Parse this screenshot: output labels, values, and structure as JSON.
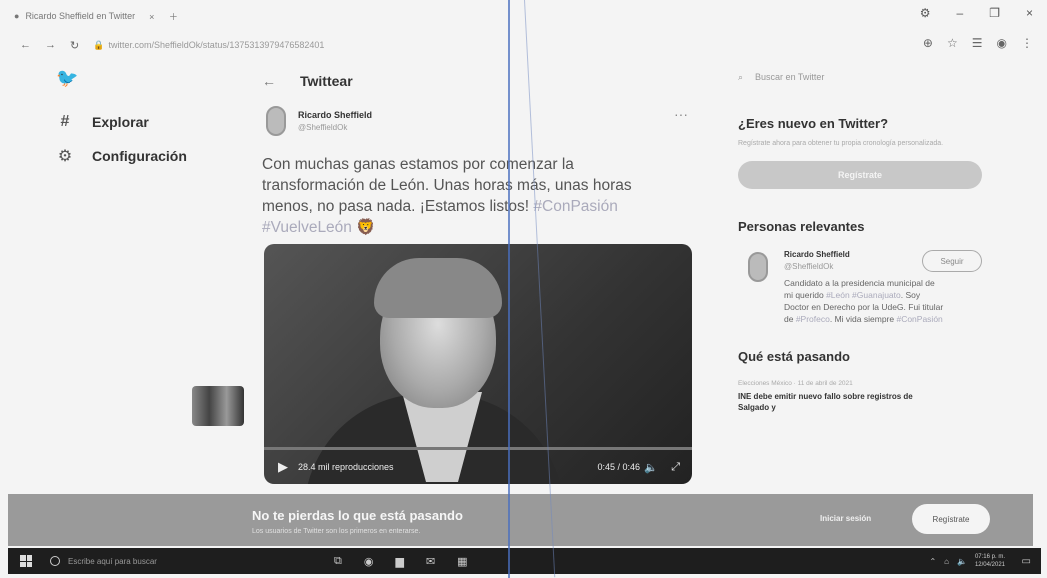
{
  "browser": {
    "tab_title": "Ricardo Sheffield en Twitter",
    "url": "twitter.com/SheffieldOk/status/1375313979476582401"
  },
  "nav": {
    "items": [
      {
        "icon": "hashtag-icon",
        "label": "Explorar"
      },
      {
        "icon": "gear-icon",
        "label": "Configuración"
      }
    ]
  },
  "tweet": {
    "header_title": "Twittear",
    "author_name": "Ricardo Sheffield",
    "author_handle": "@SheffieldOk",
    "text_line1": "Con muchas ganas estamos por comenzar la",
    "text_line2": "transformación de León. Unas horas más, unas horas",
    "text_line3": "menos, no pasa nada. ¡Estamos listos! ",
    "hashtag1": "#ConPasión",
    "hashtag2": "#VuelveLeón",
    "video_views": "28.4 mil reproducciones",
    "video_time": "0:45 / 0:46"
  },
  "sidebar": {
    "search_placeholder": "Buscar en Twitter",
    "new_title": "¿Eres nuevo en Twitter?",
    "new_subtitle": "Regístrate ahora para obtener tu propia cronología personalizada.",
    "register_label": "Regístrate",
    "people_title": "Personas relevantes",
    "person_name": "Ricardo Sheffield",
    "person_handle": "@SheffieldOk",
    "follow_label": "Seguir",
    "bio_part1": "Candidato a la presidencia municipal de mi querido ",
    "bio_tag1": "#León #Guanajuato",
    "bio_part2": ". Soy Doctor en Derecho por la UdeG. Fui titular de ",
    "bio_tag2": "#Profeco",
    "bio_part3": ". Mi vida siempre ",
    "bio_tag3": "#ConPasión",
    "trends_title": "Qué está pasando",
    "trend_meta": "Elecciones México · 11 de abril de 2021",
    "trend_headline": "INE debe emitir nuevo fallo sobre registros de Salgado y"
  },
  "banner": {
    "title": "No te pierdas lo que está pasando",
    "subtitle": "Los usuarios de Twitter son los primeros en enterarse.",
    "login_label": "Iniciar sesión",
    "register_label": "Regístrate"
  },
  "taskbar": {
    "search_placeholder": "Escribe aquí para buscar",
    "time": "07:16 p. m.",
    "date": "12/04/2021"
  }
}
